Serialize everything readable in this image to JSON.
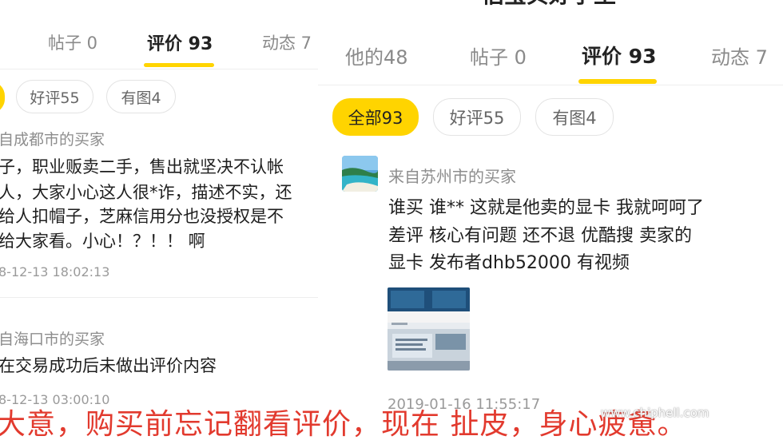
{
  "left": {
    "tabs": [
      {
        "label": "帖子 0",
        "active": false
      },
      {
        "label": "评价 93",
        "active": true
      },
      {
        "label": "动态 7",
        "active": false
      }
    ],
    "filters": [
      {
        "label": "好评55"
      },
      {
        "label": "有图4"
      }
    ],
    "reviews": [
      {
        "from": "自成都市的买家",
        "lines": [
          "子，职业贩卖二手，售出就坚决不认帐",
          "人，大家小心这人很*诈，描述不实，还",
          "给人扣帽子，芝麻信用分也没授权是不",
          "给大家看。小心！？！！ 啊"
        ],
        "time": "8-12-13 18:02:13"
      },
      {
        "from": "自海口市的买家",
        "lines": [
          "在交易成功后未做出评价内容"
        ],
        "time": "8-12-13 03:00:10"
      }
    ]
  },
  "right": {
    "title": "估宝贝好学生",
    "tabs": [
      {
        "label": "他的48",
        "active": false
      },
      {
        "label": "帖子 0",
        "active": false
      },
      {
        "label": "评价 93",
        "active": true
      },
      {
        "label": "动态 7",
        "active": false
      }
    ],
    "filters": [
      {
        "label": "全部93",
        "active": true
      },
      {
        "label": "好评55",
        "active": false
      },
      {
        "label": "有图4",
        "active": false
      }
    ],
    "review": {
      "from": "来自苏州市的买家",
      "lines": [
        "谁买 谁** 这就是他卖的显卡 我就呵呵了",
        "差评   核心有问题 还不退 优酷搜  卖家的",
        "显卡   发布者dhb52000  有视频"
      ],
      "time": "2019-01-16 11:55:17"
    }
  },
  "caption": "大意，购买前忘记翻看评价，现在 扯皮，身心疲惫。",
  "watermark": {
    "logo": "chiphell",
    "url": "www.chiphell.com"
  },
  "colors": {
    "accent": "#ffd400",
    "caption": "#e23a2e"
  }
}
